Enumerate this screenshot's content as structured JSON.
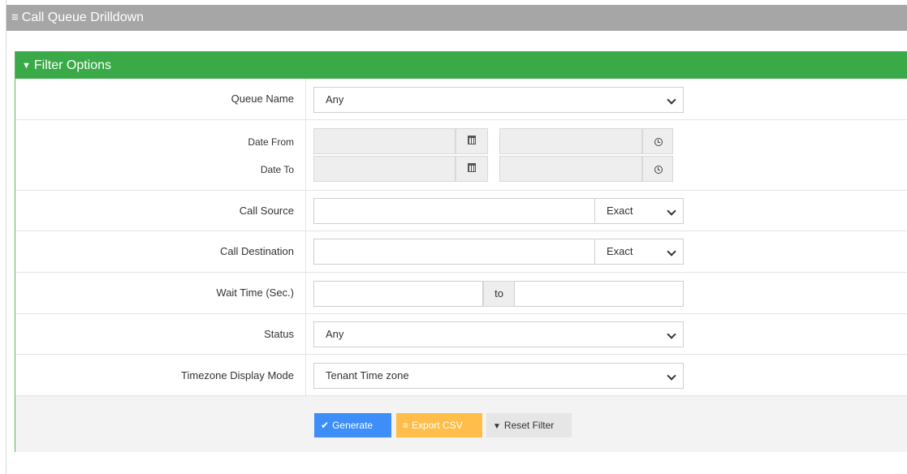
{
  "header": {
    "title": "Call Queue Drilldown",
    "icon": "hamburger-icon"
  },
  "panel": {
    "title": "Filter Options",
    "icon": "filter-icon",
    "accent": "#3aaa48"
  },
  "filters": {
    "queue_name": {
      "label": "Queue Name",
      "value": "Any"
    },
    "date_from": {
      "label": "Date From",
      "date_value": "",
      "time_value": ""
    },
    "date_to": {
      "label": "Date To",
      "date_value": "",
      "time_value": ""
    },
    "call_source": {
      "label": "Call Source",
      "value": "",
      "match": "Exact"
    },
    "call_destination": {
      "label": "Call Destination",
      "value": "",
      "match": "Exact"
    },
    "wait_time": {
      "label": "Wait Time (Sec.)",
      "from": "",
      "to_label": "to",
      "to": ""
    },
    "status": {
      "label": "Status",
      "value": "Any"
    },
    "timezone": {
      "label": "Timezone Display Mode",
      "value": "Tenant Time zone"
    }
  },
  "buttons": {
    "generate": {
      "label": "Generate",
      "color": "#3d8ef8",
      "icon": "check-icon"
    },
    "export_csv": {
      "label": "Export CSV",
      "color": "#ffbd4a",
      "icon": "list-icon"
    },
    "reset": {
      "label": "Reset Filter",
      "icon": "filter-icon"
    }
  }
}
